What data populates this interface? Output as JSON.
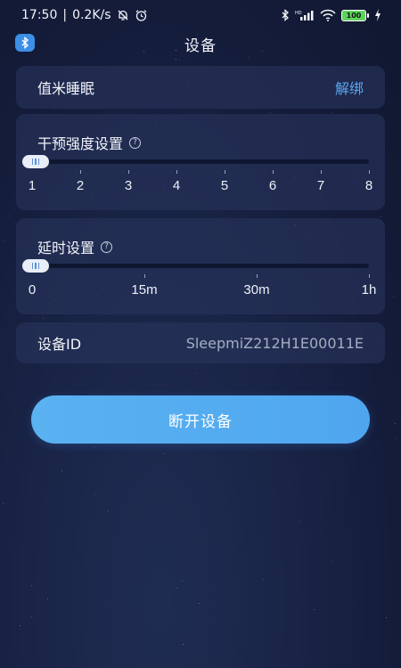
{
  "status_bar": {
    "time": "17:50",
    "network_speed": "0.2K/s",
    "battery_level": "100",
    "icons": [
      "mute-bell-icon",
      "alarm-icon",
      "bluetooth-icon",
      "hd-signal-icon",
      "wifi-icon",
      "battery-icon",
      "charging-icon"
    ]
  },
  "header": {
    "title": "设备",
    "left_icon": "bluetooth-icon"
  },
  "device_card": {
    "name": "值米睡眠",
    "unbind_label": "解绑"
  },
  "intensity": {
    "title": "干预强度设置",
    "help_icon": "question-circle-icon",
    "ticks": [
      "1",
      "2",
      "3",
      "4",
      "5",
      "6",
      "7",
      "8"
    ],
    "value_index": 0
  },
  "delay": {
    "title": "延时设置",
    "help_icon": "question-circle-icon",
    "ticks": [
      "0",
      "15m",
      "30m",
      "1h"
    ],
    "value_index": 0
  },
  "device_id": {
    "label": "设备ID",
    "value": "SleepmiZ212H1E00011E"
  },
  "disconnect_button": {
    "label": "断开设备"
  },
  "colors": {
    "accent": "#4fa6ef",
    "link": "#5aa8f2",
    "background": "#141c3a",
    "card": "#28345c"
  }
}
